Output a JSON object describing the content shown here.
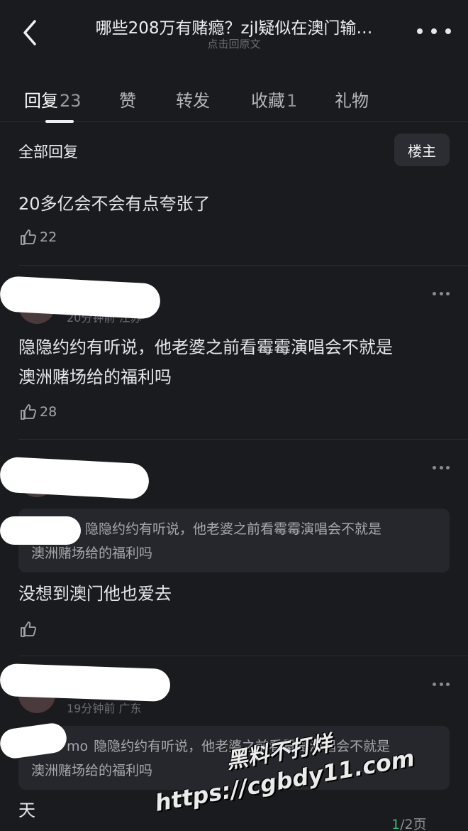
{
  "header": {
    "title": "哪些208万有赌瘾？zjl疑似在澳门输…",
    "subtitle": "点击回原文"
  },
  "tabs": [
    {
      "label": "回复",
      "count": "23",
      "active": true
    },
    {
      "label": "赞",
      "count": ""
    },
    {
      "label": "转发",
      "count": ""
    },
    {
      "label": "收藏",
      "count": "1"
    },
    {
      "label": "礼物",
      "count": ""
    }
  ],
  "filter": {
    "label": "全部回复",
    "op_button": "楼主"
  },
  "comments": [
    {
      "text": "20多亿会不会有点夸张了",
      "likes": "22"
    },
    {
      "meta": "20分钟前 江苏",
      "text_line1": "隐隐约约有听说，他老婆之前看霉霉演唱会不就是",
      "text_line2": "澳洲赌场给的福利吗",
      "likes": "28"
    },
    {
      "quote_line1": "隐隐约约有听说，他老婆之前看霉霉演唱会不就是",
      "quote_line2": "澳洲赌场给的福利吗",
      "text": "没想到澳门他也爱去",
      "likes": ""
    },
    {
      "meta": "19分钟前 广东",
      "quote_author": "mo",
      "quote_line1": "隐隐约约有听说，他老婆之前看霉霉演唱会不就是",
      "quote_line2": "澳洲赌场给的福利吗",
      "text": "天"
    }
  ],
  "pager": {
    "current": "1",
    "total_text": "/2页"
  },
  "watermark": {
    "line1": "黑料不打烊",
    "line2": "https://cgbdy11.com"
  },
  "colors": {
    "background": "#1a1b1f",
    "text": "#e8e8ea",
    "muted": "#6d6e74",
    "accent_green": "#3fb56a"
  }
}
